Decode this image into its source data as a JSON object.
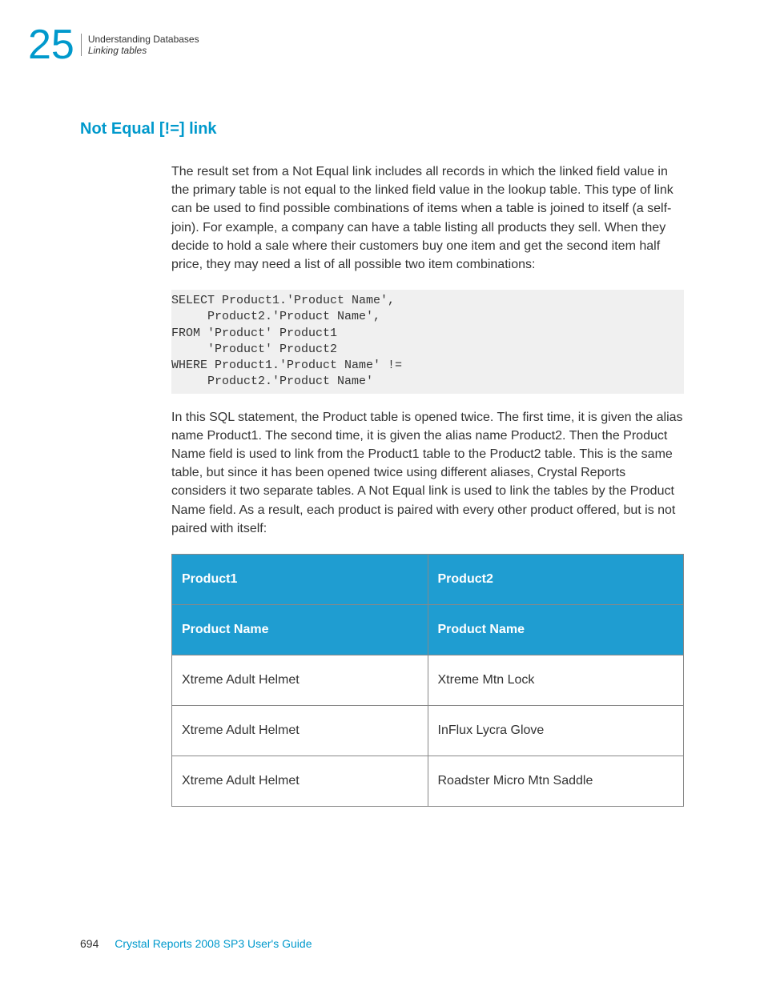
{
  "header": {
    "chapter_number": "25",
    "title": "Understanding Databases",
    "subtitle": "Linking tables"
  },
  "section": {
    "heading": "Not Equal [!=] link",
    "paragraph1": "The result set from a Not Equal link includes all records in which the linked field value in the primary table is not equal to the linked field value in the lookup table. This type of link can be used to find possible combinations of items when a table is joined to itself (a self-join). For example, a company can have a table listing all products they sell. When they decide to hold a sale where their customers buy one item and get the second item half price, they may need a list of all possible two item combinations:",
    "code": "SELECT Product1.'Product Name',\n     Product2.'Product Name',\nFROM 'Product' Product1\n     'Product' Product2\nWHERE Product1.'Product Name' !=\n     Product2.'Product Name'",
    "paragraph2": "In this SQL statement, the Product table is opened twice. The first time, it is given the alias name Product1. The second time, it is given the alias name Product2. Then the Product Name field is used to link from the Product1 table to the Product2 table. This is the same table, but since it has been opened twice using different aliases, Crystal Reports considers it two separate tables. A Not Equal link is used to link the tables by the Product Name field. As a result, each product is paired with every other product offered, but is not paired with itself:"
  },
  "table": {
    "header1": "Product1",
    "header2": "Product2",
    "subheader1": "Product Name",
    "subheader2": "Product Name",
    "rows": [
      {
        "col1": "Xtreme Adult Helmet",
        "col2": "Xtreme Mtn Lock"
      },
      {
        "col1": "Xtreme Adult Helmet",
        "col2": "InFlux Lycra Glove"
      },
      {
        "col1": "Xtreme Adult Helmet",
        "col2": "Roadster Micro Mtn Saddle"
      }
    ]
  },
  "footer": {
    "page_number": "694",
    "title": "Crystal Reports 2008 SP3 User's Guide"
  }
}
